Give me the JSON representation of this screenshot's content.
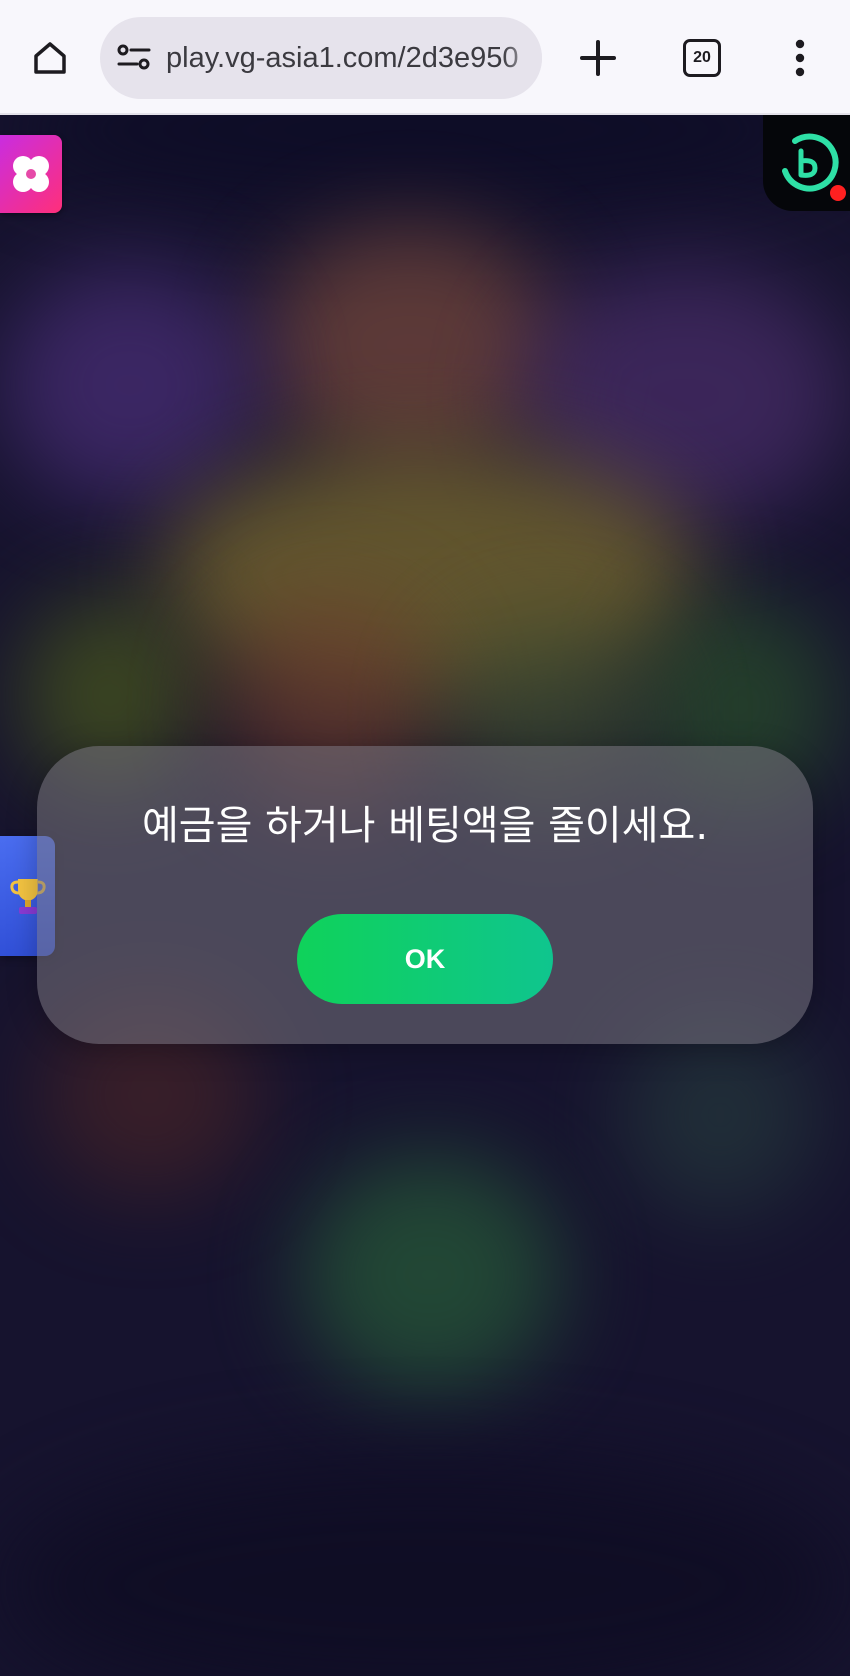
{
  "browser": {
    "url": "play.vg-asia1.com/2d3e950",
    "tab_count": "20",
    "icons": {
      "home": "home-icon",
      "site_info": "site-settings-icon",
      "new_tab": "plus-icon",
      "tabs": "tab-switcher-icon",
      "menu": "more-vert-icon"
    }
  },
  "game": {
    "left_badge_icon": "clover-icon",
    "brand_logo_icon": "brand-logo-icon",
    "side_tab_icon": "trophy-icon",
    "dialog": {
      "message": "예금을 하거나 베팅액을 줄이세요.",
      "ok_label": "OK"
    },
    "colors": {
      "ok_button": "#10cf74",
      "badge": "#e02fb0",
      "logo_accent": "#2ee0a6",
      "trophy_tab": "#3d5ce4"
    }
  }
}
